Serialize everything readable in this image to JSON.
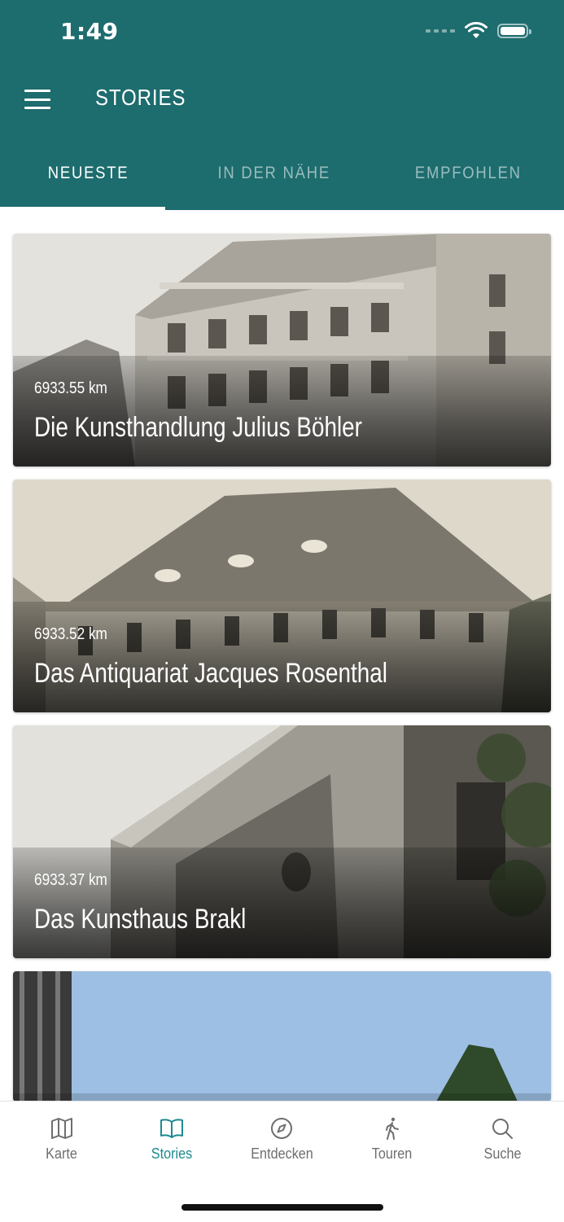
{
  "status": {
    "time": "1:49"
  },
  "header": {
    "title": "STORIES"
  },
  "tabs": [
    {
      "label": "NEUESTE",
      "active": true
    },
    {
      "label": "IN DER NÄHE",
      "active": false
    },
    {
      "label": "EMPFOHLEN",
      "active": false
    }
  ],
  "stories": [
    {
      "distance": "6933.55 km",
      "title": "Die Kunsthandlung Julius Böhler"
    },
    {
      "distance": "6933.52 km",
      "title": "Das Antiquariat Jacques Rosenthal"
    },
    {
      "distance": "6933.37 km",
      "title": "Das Kunsthaus Brakl"
    }
  ],
  "nav": [
    {
      "label": "Karte",
      "icon": "map-icon",
      "active": false
    },
    {
      "label": "Stories",
      "icon": "book-icon",
      "active": true
    },
    {
      "label": "Entdecken",
      "icon": "compass-icon",
      "active": false
    },
    {
      "label": "Touren",
      "icon": "walking-icon",
      "active": false
    },
    {
      "label": "Suche",
      "icon": "search-icon",
      "active": false
    }
  ],
  "colors": {
    "primary": "#1d6c6e",
    "nav_active": "#1d8a8f",
    "nav_inactive": "#6e6e6e"
  }
}
